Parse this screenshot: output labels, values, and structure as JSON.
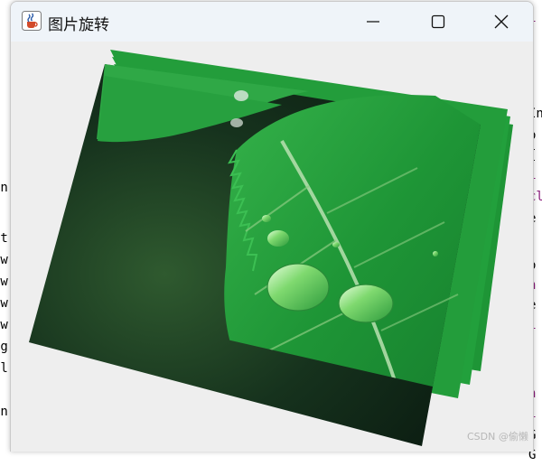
{
  "background_editor": {
    "left_fragments": [
      "en",
      "lt",
      "aw",
      "aw",
      "aw",
      "aw",
      "ng",
      "tl",
      "a",
      "In"
    ],
    "right_fragments": [
      "i",
      ".",
      ".",
      "",
      "In",
      "o",
      "{",
      "i",
      "cl",
      "e",
      "",
      "o",
      "n",
      "e",
      "i",
      "",
      "",
      "n",
      "i",
      "G",
      "G"
    ]
  },
  "window": {
    "title": "图片旋转",
    "icon": "java-coffee-cup-icon",
    "controls": {
      "minimize": "minimize-icon",
      "maximize": "maximize-icon",
      "close": "close-icon"
    }
  },
  "image": {
    "subject": "green leaf with water droplets",
    "frames": 4,
    "colors": {
      "leaf": "#1f9a3a",
      "leaf_light": "#3fbf55",
      "vein": "#b9e0b0",
      "dark_bg": "#0f2a18"
    }
  },
  "watermark": "CSDN @偷懒"
}
